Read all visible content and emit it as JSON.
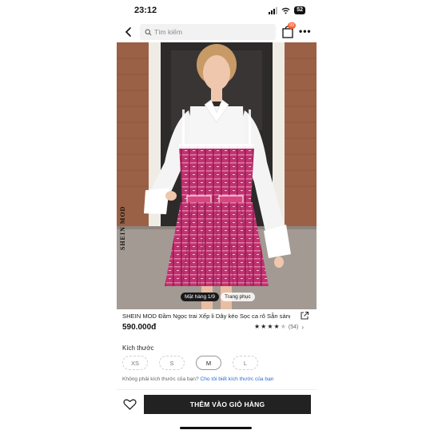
{
  "status_bar": {
    "time": "23:12",
    "battery": "52"
  },
  "header": {
    "search_placeholder": "Tìm kiếm",
    "bag_badge": "99"
  },
  "gallery": {
    "tabs": [
      "Mặt hàng 1/9",
      "Trang phục"
    ],
    "brand_mark": "SHEIN MOD"
  },
  "product": {
    "title": "SHEIN MOD Đầm Ngọc trai Xếp li Dây kéo Sọc ca rô Sẵn sàng",
    "price": "590.000đ",
    "rating_count": "(54)",
    "rating": 4.5
  },
  "sizes": {
    "label": "Kích thước",
    "options": [
      "XS",
      "S",
      "M",
      "L"
    ],
    "selected": "M"
  },
  "size_help": {
    "question": "Không phải kích thước của bạn?",
    "link": "Cho tôi biết kích thước của bạn"
  },
  "cta": {
    "add_to_cart": "THÊM VÀO GIỎ HÀNG"
  },
  "colors": {
    "accent_badge": "#fa6338",
    "button": "#222222",
    "link": "#2b6ccf",
    "dress": "#c2306f"
  }
}
